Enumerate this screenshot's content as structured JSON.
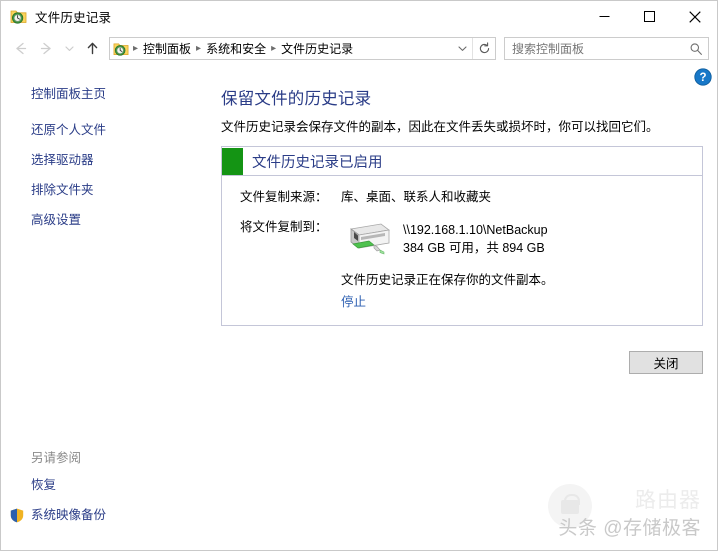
{
  "window": {
    "title": "文件历史记录",
    "icon": "file-history-icon",
    "controls": {
      "minimize": "最小化",
      "maximize": "最大化",
      "close": "关闭"
    }
  },
  "navbar": {
    "back": "后退",
    "forward": "前进",
    "recent": "最近浏览的位置",
    "up": "上移一级",
    "breadcrumbs": [
      {
        "label": "控制面板"
      },
      {
        "label": "系统和安全"
      },
      {
        "label": "文件历史记录"
      }
    ],
    "dropdown": "历史记录",
    "refresh": "刷新",
    "search": {
      "placeholder": "搜索控制面板",
      "value": "",
      "icon": "search-icon"
    }
  },
  "sidebar": {
    "home": "控制面板主页",
    "items": [
      {
        "label": "还原个人文件"
      },
      {
        "label": "选择驱动器"
      },
      {
        "label": "排除文件夹"
      },
      {
        "label": "高级设置"
      }
    ],
    "see_also": {
      "title": "另请参阅",
      "items": [
        {
          "label": "恢复",
          "icon": ""
        },
        {
          "label": "系统映像备份",
          "icon": "shield-icon"
        }
      ]
    }
  },
  "content": {
    "help": "帮助",
    "title": "保留文件的历史记录",
    "description": "文件历史记录会保存文件的副本，因此在文件丢失或损坏时，你可以找回它们。",
    "status_panel": {
      "status_color": "#149414",
      "status_title": "文件历史记录已启用",
      "source_label": "文件复制来源：",
      "source_value": "库、桌面、联系人和收藏夹",
      "target_label": "将文件复制到：",
      "drive_icon": "network-drive-icon",
      "drive_path": "\\\\192.168.1.10\\NetBackup",
      "drive_space": "384 GB 可用，共 894 GB",
      "note": "文件历史记录正在保存你的文件副本。",
      "stop_link": "停止"
    },
    "close_button": "关闭"
  },
  "watermarks": {
    "router": "路由器",
    "brand": "头条 @存储极客"
  }
}
